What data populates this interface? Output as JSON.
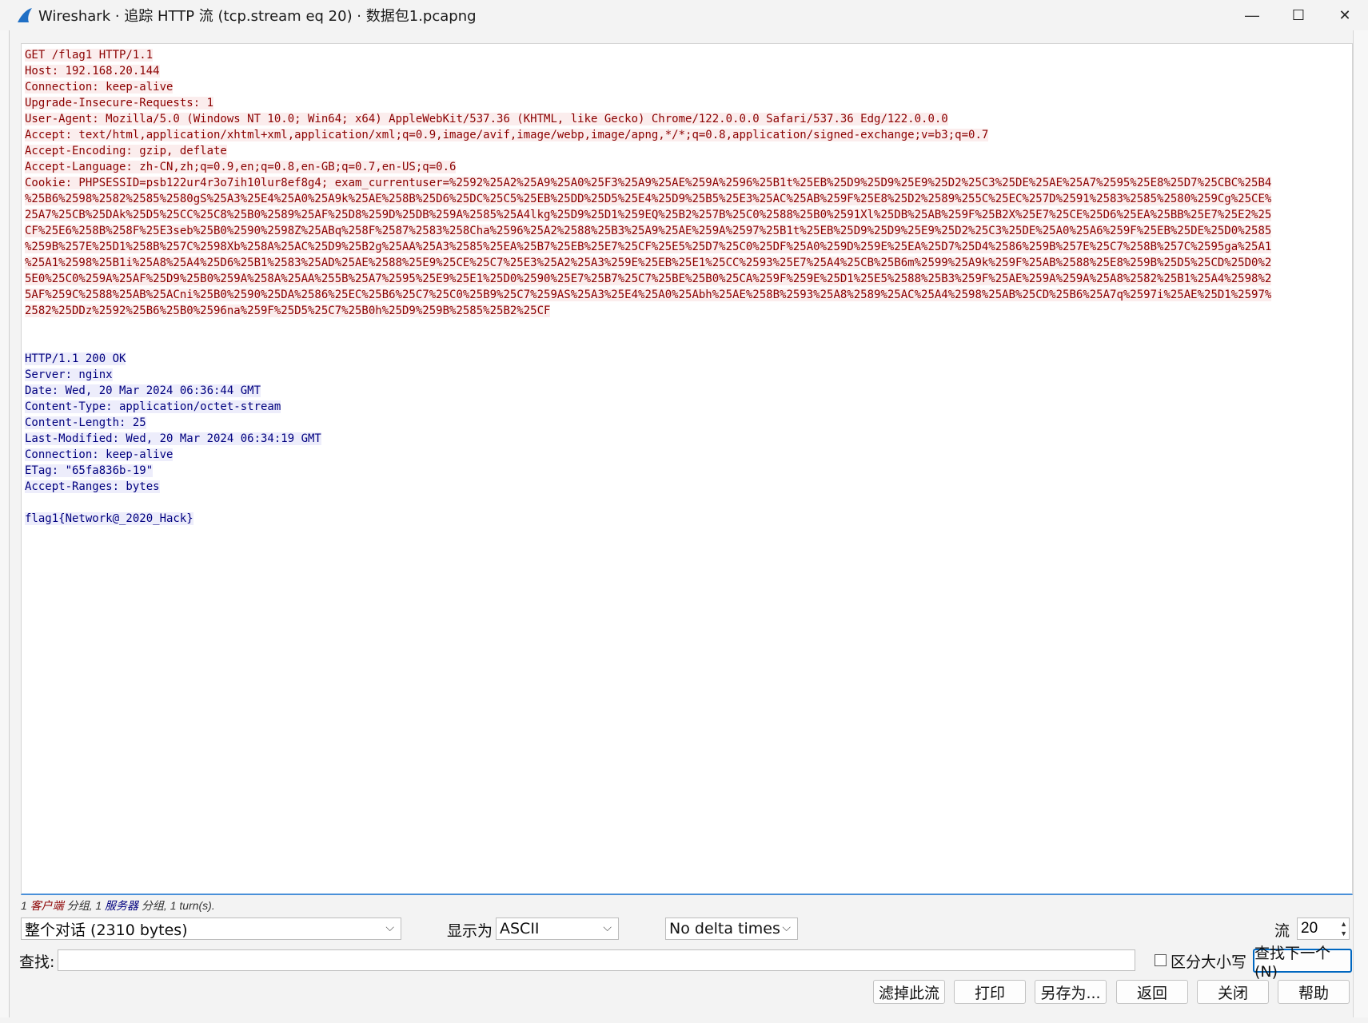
{
  "window": {
    "title": "Wireshark · 追踪 HTTP 流 (tcp.stream eq 20) · 数据包1.pcapng",
    "icon": "wireshark-fin-icon",
    "min_glyph": "—",
    "max_glyph": "☐",
    "close_glyph": "✕"
  },
  "colors": {
    "client": "#8b0000",
    "client_bg": "#fbeded",
    "server": "#00007f",
    "server_bg": "#ededfb",
    "accent": "#0067c0"
  },
  "stream": {
    "client_lines": [
      "GET /flag1 HTTP/1.1",
      "Host: 192.168.20.144",
      "Connection: keep-alive",
      "Upgrade-Insecure-Requests: 1",
      "User-Agent: Mozilla/5.0 (Windows NT 10.0; Win64; x64) AppleWebKit/537.36 (KHTML, like Gecko) Chrome/122.0.0.0 Safari/537.36 Edg/122.0.0.0",
      "Accept: text/html,application/xhtml+xml,application/xml;q=0.9,image/avif,image/webp,image/apng,*/*;q=0.8,application/signed-exchange;v=b3;q=0.7",
      "Accept-Encoding: gzip, deflate",
      "Accept-Language: zh-CN,zh;q=0.9,en;q=0.8,en-GB;q=0.7,en-US;q=0.6"
    ],
    "cookie_lines": [
      "Cookie: PHPSESSID=psb122ur4r3o7ih10lur8ef8g4; exam_currentuser=%2592%25A2%25A9%25A0%25F3%25A9%25AE%259A%2596%25B1t%25EB%25D9%25D9%25E9%25D2%25C3%25DE%25AE%25A7%2595%25E8%25D7%25CBC%25B4",
      "%25B6%2598%2582%2585%2580gS%25A3%25E4%25A0%25A9k%25AE%258B%25D6%25DC%25C5%25EB%25DD%25D5%25E4%25D9%25B5%25E3%25AC%25AB%259F%25E8%25D2%2589%255C%25EC%257D%2591%2583%2585%2580%259Cg%25CE%",
      "25A7%25CB%25DAk%25D5%25CC%25C8%25B0%2589%25AF%25D8%259D%25DB%259A%2585%25A4lkg%25D9%25D1%259EQ%25B2%257B%25C0%2588%25B0%2591Xl%25DB%25AB%259F%25B2X%25E7%25CE%25D6%25EA%25BB%25E7%25E2%25",
      "CF%25E6%258B%258F%25E3seb%25B0%2590%2598Z%25ABq%258F%2587%2583%258Cha%2596%25A2%2588%25B3%25A9%25AE%259A%2597%25B1t%25EB%25D9%25D9%25E9%25D2%25C3%25DE%25A0%25A6%259F%25EB%25DE%25D0%2585",
      "%259B%257E%25D1%258B%257C%2598Xb%258A%25AC%25D9%25B2g%25AA%25A3%2585%25EA%25B7%25EB%25E7%25CF%25E5%25D7%25C0%25DF%25A0%259D%259E%25EA%25D7%25D4%2586%259B%257E%25C7%258B%257C%2595ga%25A1",
      "%25A1%2598%25B1i%25A8%25A4%25D6%25B1%2583%25AD%25AE%2588%25E9%25CE%25C7%25E3%25A2%25A3%259E%25EB%25E1%25CC%2593%25E7%25A4%25CB%25B6m%2599%25A9k%259F%25AB%2588%25E8%259B%25D5%25CD%25D0%2",
      "5E0%25C0%259A%25AF%25D9%25B0%259A%258A%25AA%255B%25A7%2595%25E9%25E1%25D0%2590%25E7%25B7%25C7%25BE%25B0%25CA%259F%259E%25D1%25E5%2588%25B3%259F%25AE%259A%259A%25A8%2582%25B1%25A4%2598%2",
      "5AF%259C%2588%25AB%25ACni%25B0%2590%25DA%2586%25EC%25B6%25C7%25C0%25B9%25C7%259AS%25A3%25E4%25A0%25Abh%25AE%258B%2593%25A8%2589%25AC%25A4%2598%25AB%25CD%25B6%25A7q%2597i%25AE%25D1%2597%",
      "2582%25DDz%2592%25B6%25B0%2596na%259F%25D5%25C7%25B0h%25D9%259B%2585%25B2%25CF"
    ],
    "server_lines": [
      "HTTP/1.1 200 OK",
      "Server: nginx",
      "Date: Wed, 20 Mar 2024 06:36:44 GMT",
      "Content-Type: application/octet-stream",
      "Content-Length: 25",
      "Last-Modified: Wed, 20 Mar 2024 06:34:19 GMT",
      "Connection: keep-alive",
      "ETag: \"65fa836b-19\"",
      "Accept-Ranges: bytes"
    ],
    "body": "flag1{Network@_2020_Hack}"
  },
  "stats": {
    "c_num": "1 ",
    "c_word": "客户端",
    "c_tail": " 分组, ",
    "s_num": "1 ",
    "s_word": "服务器",
    "s_tail": " 分组, 1 turn(s)."
  },
  "controls": {
    "conversation": "整个对话 (2310 bytes)",
    "show_as_label": "显示为",
    "show_as": "ASCII",
    "delta": "No delta times",
    "stream_label": "流",
    "stream_value": "20"
  },
  "find": {
    "label": "查找:",
    "case_label": "区分大小写",
    "next_button": "查找下一个(N)"
  },
  "buttons": {
    "filter_out": "滤掉此流",
    "print": "打印",
    "save_as": "另存为...",
    "back": "返回",
    "close": "关闭",
    "help": "帮助"
  }
}
